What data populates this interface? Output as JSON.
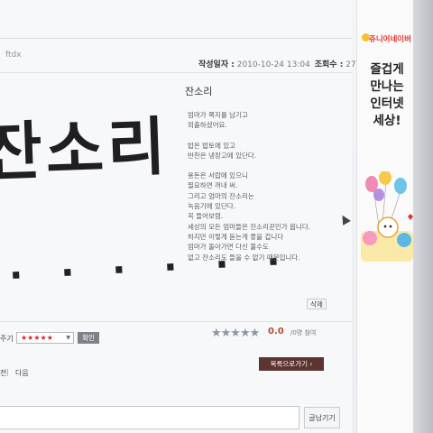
{
  "post": {
    "filename": "ftdx",
    "date_label": "작성일자 :",
    "date_value": "2010-10-24 13:04",
    "views_label": "조회수 :",
    "views_value": "27",
    "handwriting_big": "잔소리",
    "handwriting_dots": "· · · · · ·",
    "title": "잔소리",
    "body_lines": [
      "엄마가 쪽지를 남기고",
      "외출하셨어요.",
      "",
      "밥은 밥토에 있고",
      "반찬은 냉장고에 있단다.",
      "",
      "용돈은 서랍에 있으니",
      "필요하면 꺼내 써.",
      "그리고 엄마의 잔소리는",
      "녹음기에 있단다.",
      "꼭 들어보렴.",
      "세상의 모든 엄마들은 잔소리꾼인가 봅니다.",
      "하지만 이렇게 듣는게 좋을 겁니다",
      "엄마가 돌아가면 다신 볼수도",
      "없고 잔소리도 들을 수 없기 때문입니다."
    ],
    "delete_label": "삭제"
  },
  "rating": {
    "label": "주기",
    "select_value": "★★★★★",
    "confirm_label": "확인",
    "avg_stars": "★★★★★",
    "score": "0.0",
    "participants": "/0명 참여"
  },
  "nav": {
    "prev_label": "전",
    "next_label": "다음",
    "list_label": "목록으로가기 ›"
  },
  "comment": {
    "write_label": "글남기기"
  },
  "ad": {
    "brand": "쥬니어네이버",
    "line1": "즐겁게",
    "line2": "만나는",
    "line3": "인터넷",
    "line4": "세상!"
  },
  "colors": {
    "list_button": "#5c3530",
    "score": "#b34c2c",
    "brand": "#e3342f"
  }
}
